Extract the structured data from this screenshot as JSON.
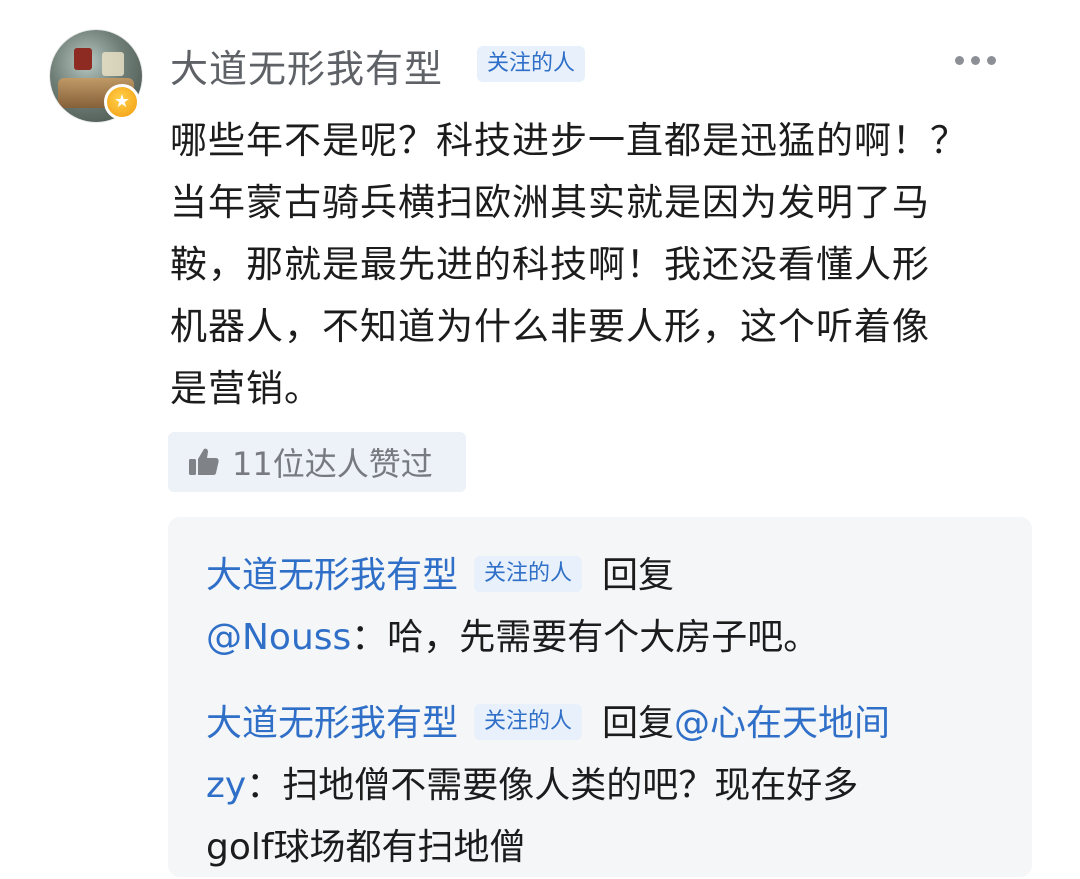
{
  "post": {
    "username": "大道无形我有型",
    "follow_tag": "关注的人",
    "more_icon": "more-dots-icon",
    "content": "哪些年不是呢？科技进步一直都是迅猛的啊！？\n当年蒙古骑兵横扫欧洲其实就是因为发明了马\n鞍，那就是最先进的科技啊！我还没看懂人形\n机器人，不知道为什么非要人形，这个听着像\n是营销。",
    "likes_label": "11位达人赞过"
  },
  "replies": [
    {
      "user": "大道无形我有型",
      "tag": "关注的人",
      "reply_word": "回复",
      "target_line1": "",
      "target_line2": "@Nouss",
      "text": "：哈，先需要有个大房子吧。"
    },
    {
      "user": "大道无形我有型",
      "tag": "关注的人",
      "reply_word": "回复",
      "target_line1": "@心在天地间",
      "target_line2": "zy",
      "text": "：扫地僧不需要像人类的吧？现在好多",
      "text_line3": "golf球场都有扫地僧"
    }
  ],
  "colors": {
    "link": "#2f6fc8",
    "tag_bg": "#e7f0fb",
    "reply_panel_bg": "#f5f6f8"
  }
}
